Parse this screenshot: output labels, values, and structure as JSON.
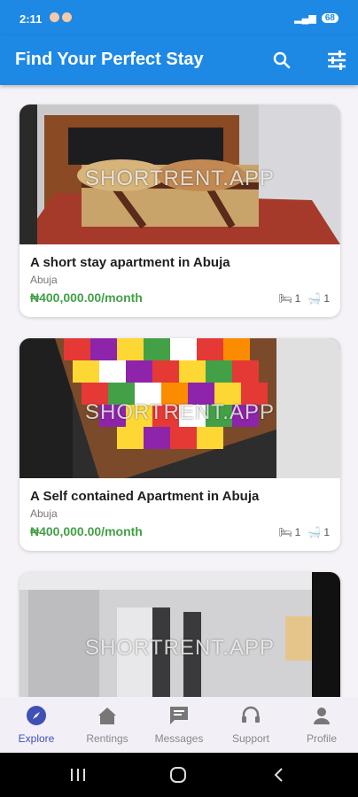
{
  "status_bar": {
    "time": "2:11",
    "battery": "68"
  },
  "app_bar": {
    "title": "Find Your Perfect Stay"
  },
  "watermark": "SHORTRENT.APP",
  "listings": [
    {
      "title": "A short stay apartment in Abuja",
      "location": "Abuja",
      "price": "₦400,000.00/month",
      "beds": "1",
      "baths": "1"
    },
    {
      "title": "A Self contained Apartment in Abuja",
      "location": "Abuja",
      "price": "₦400,000.00/month",
      "beds": "1",
      "baths": "1"
    },
    {
      "title": "",
      "location": "",
      "price": "",
      "beds": "",
      "baths": ""
    }
  ],
  "bottom_nav": {
    "explore": "Explore",
    "rentings": "Rentings",
    "messages": "Messages",
    "support": "Support",
    "profile": "Profile"
  },
  "colors": {
    "primary": "#1e88e5",
    "price": "#43a047",
    "nav_active": "#3f51b5"
  }
}
